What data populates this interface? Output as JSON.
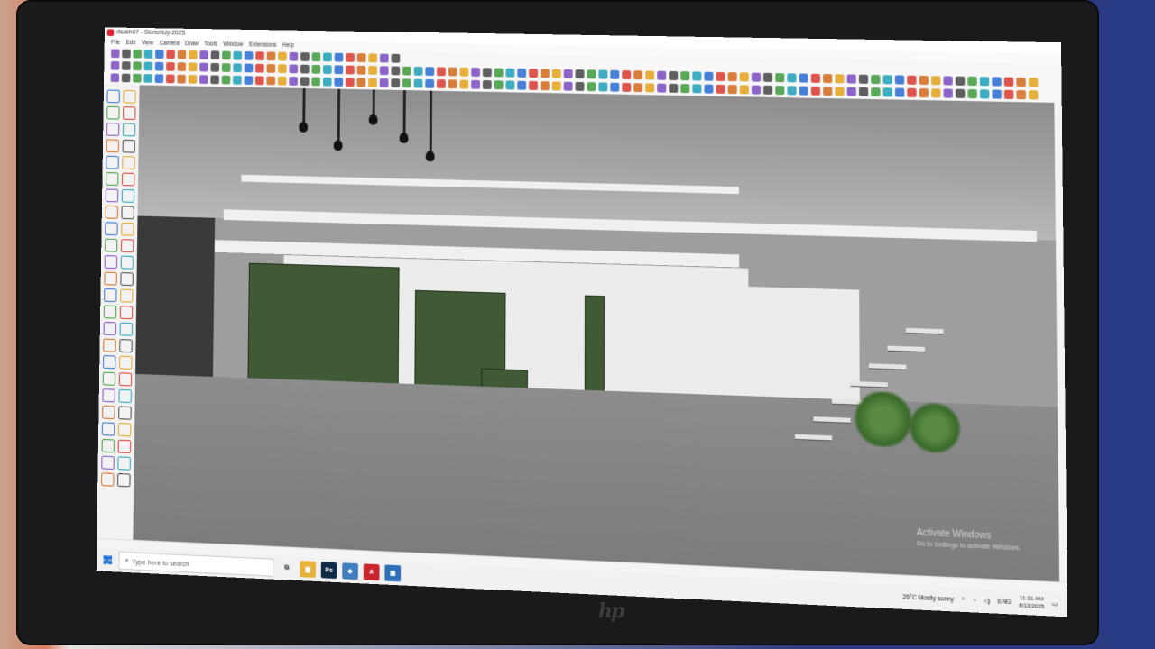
{
  "window": {
    "title": "dsakh07 - SketchUp 2025"
  },
  "menu": [
    "File",
    "Edit",
    "View",
    "Camera",
    "Draw",
    "Tools",
    "Window",
    "Extensions",
    "Help"
  ],
  "toolbar_colors": [
    "#2a6bd1",
    "#e3a21a",
    "#3c9a3c",
    "#d9382f",
    "#7a4bc1",
    "#1ea0b7",
    "#d46a1c",
    "#444444"
  ],
  "viewport": {
    "watermark_title": "Activate Windows",
    "watermark_sub": "Go to Settings to activate Windows."
  },
  "taskbar": {
    "search_placeholder": "Type here to search",
    "apps": [
      {
        "name": "file-explorer",
        "glyph": "▆",
        "color": "#e8b23a"
      },
      {
        "name": "photoshop",
        "glyph": "Ps",
        "color": "#0e2a47"
      },
      {
        "name": "sketchup",
        "glyph": "◆",
        "color": "#3f7fc0"
      },
      {
        "name": "autocad",
        "glyph": "A",
        "color": "#c8262b"
      },
      {
        "name": "calculator",
        "glyph": "▦",
        "color": "#2f6fb8"
      }
    ],
    "weather": "26°C  Mostly sunny",
    "language": "ENG",
    "time": "11:31 AM",
    "date": "8/13/2025"
  },
  "device": {
    "brand": "hp"
  }
}
